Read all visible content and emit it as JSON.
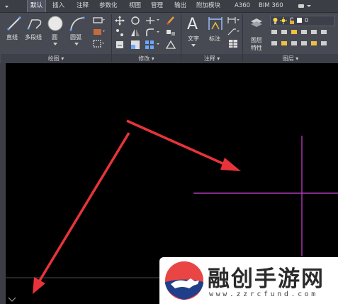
{
  "tabs": [
    {
      "label": "默认",
      "active": true
    },
    {
      "label": "插入",
      "active": false
    },
    {
      "label": "注释",
      "active": false
    },
    {
      "label": "参数化",
      "active": false
    },
    {
      "label": "视图",
      "active": false
    },
    {
      "label": "管理",
      "active": false
    },
    {
      "label": "输出",
      "active": false
    },
    {
      "label": "附加模块",
      "active": false
    },
    {
      "label": "A360",
      "active": false
    },
    {
      "label": "BIM 360",
      "active": false
    }
  ],
  "ribbon": {
    "draw": {
      "line": "直线",
      "polyline": "多段线",
      "circle": "圆",
      "arc": "圆弧",
      "title": "绘图"
    },
    "modify": {
      "title": "修改"
    },
    "annotation": {
      "text": "文字",
      "dimension": "标注",
      "title": "注释"
    },
    "layers": {
      "layer_properties_line1": "图层",
      "layer_properties_line2": "特性",
      "current_layer": "0",
      "title": "图层"
    }
  },
  "watermark": {
    "title": "融创手游网",
    "url": "www.zzrcfund.com"
  },
  "colors": {
    "crosshair": "#b03ab8",
    "arrow": "#e8333a",
    "ribbon": "#474a52",
    "canvas": "#000000"
  }
}
